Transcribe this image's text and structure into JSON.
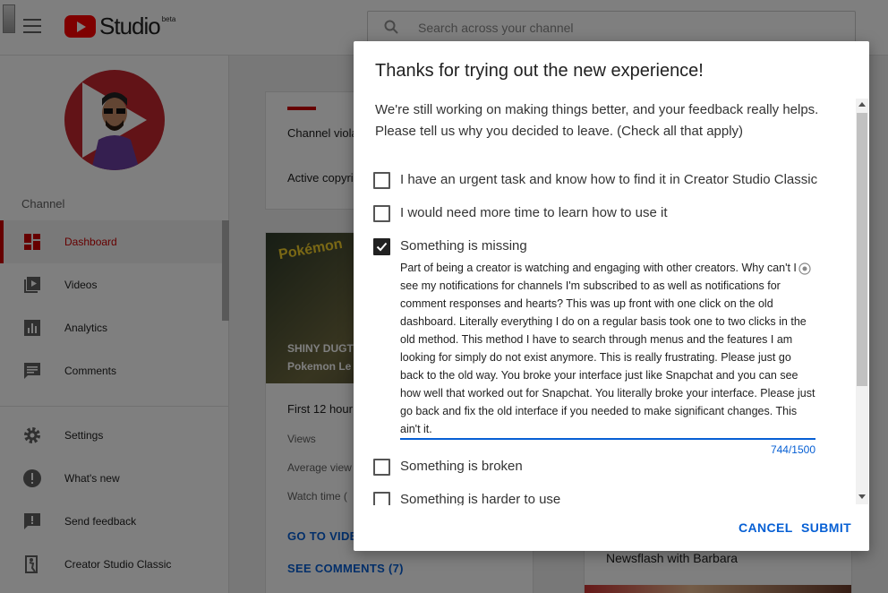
{
  "header": {
    "logo_text": "Studio",
    "logo_badge": "beta",
    "search_placeholder": "Search across your channel"
  },
  "sidebar": {
    "section_label": "Channel",
    "items": [
      {
        "label": "Dashboard",
        "icon": "dashboard-icon",
        "active": true
      },
      {
        "label": "Videos",
        "icon": "videos-icon"
      },
      {
        "label": "Analytics",
        "icon": "analytics-icon"
      },
      {
        "label": "Comments",
        "icon": "comments-icon"
      },
      {
        "label": "Settings",
        "icon": "gear-icon"
      },
      {
        "label": "What's new",
        "icon": "whats-new-icon"
      },
      {
        "label": "Send feedback",
        "icon": "feedback-icon"
      },
      {
        "label": "Creator Studio Classic",
        "icon": "exit-icon"
      }
    ]
  },
  "main": {
    "card1_line1": "Channel viola",
    "card1_line2": "Active copyri",
    "video_badge": "Pokémon",
    "video_title_1": "SHINY DUGT",
    "video_title_2": "Pokemon Le",
    "first_hours": "First 12 hour",
    "stats": [
      "Views",
      "Average view",
      "Watch time ("
    ],
    "link_video": "GO TO VIDE",
    "link_comments": "SEE COMMENTS (7)",
    "card3_title": "Newsflash with Barbara"
  },
  "dialog": {
    "title": "Thanks for trying out the new experience!",
    "intro": "We're still working on making things better, and your feedback really helps. Please tell us why you decided to leave. (Check all that apply)",
    "options": [
      {
        "label": "I have an urgent task and know how to find it in Creator Studio Classic",
        "checked": false
      },
      {
        "label": "I would need more time to learn how to use it",
        "checked": false
      },
      {
        "label": "Something is missing",
        "checked": true
      },
      {
        "label": "Something is broken",
        "checked": false
      },
      {
        "label": "Something is harder to use",
        "checked": false
      }
    ],
    "feedback_text": "Part of being a creator is watching and engaging with other creators. Why can't I see my notifications for channels I'm subscribed to as well as notifications for comment responses and hearts? This was up front with one click on the old dashboard. Literally everything I do on a regular basis took one to two clicks in the old method. This method I have to search through menus and the features I am looking for simply do not exist anymore. This is really frustrating. Please just go back to the old way. You broke your interface just like Snapchat and you can see how well that worked out for Snapchat. You literally broke your interface. Please just go back and fix the old interface if you needed to make significant changes. This ain't it.",
    "char_count": "744/1500",
    "cancel_label": "CANCEL",
    "submit_label": "SUBMIT"
  },
  "colors": {
    "brand_red": "#ff0000",
    "accent_blue": "#065fd4",
    "active_red": "#cc0000"
  }
}
